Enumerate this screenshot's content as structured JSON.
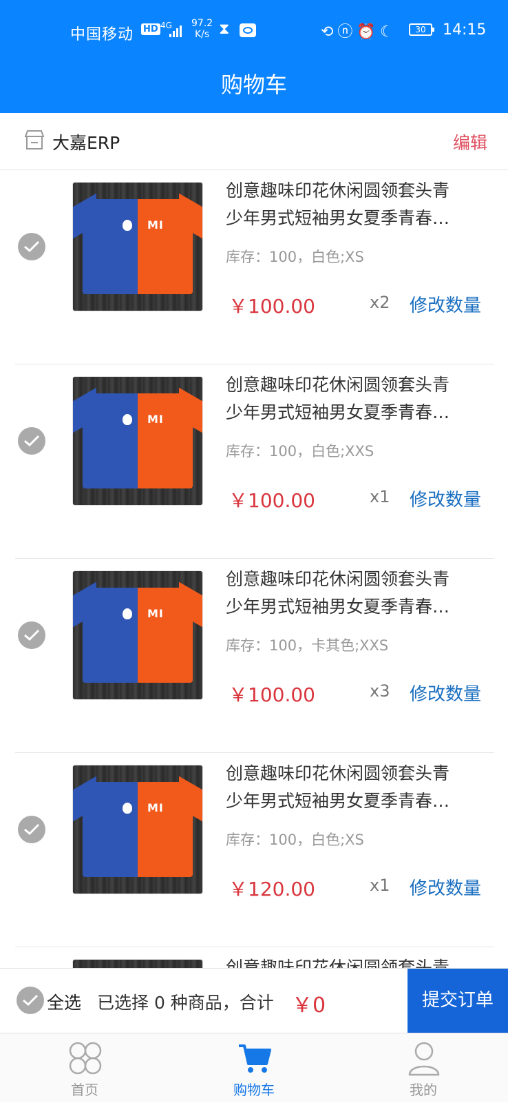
{
  "status_bar": {
    "carrier": "中国移动",
    "hd": "HD",
    "network": "4G",
    "speed_value": "97.2",
    "speed_unit": "K/s",
    "battery": "30",
    "time": "14:15"
  },
  "header": {
    "title": "购物车"
  },
  "shop": {
    "name": "大嘉ERP",
    "edit_label": "编辑"
  },
  "cart_items": [
    {
      "title": "创意趣味印花休闲圆领套头青少年男式短袖男女夏季青春…",
      "spec": "库存：100，白色;XS",
      "price": "￥100.00",
      "qty": "x2",
      "modify_label": "修改数量",
      "checked": true
    },
    {
      "title": "创意趣味印花休闲圆领套头青少年男式短袖男女夏季青春…",
      "spec": "库存：100，白色;XXS",
      "price": "￥100.00",
      "qty": "x1",
      "modify_label": "修改数量",
      "checked": true
    },
    {
      "title": "创意趣味印花休闲圆领套头青少年男式短袖男女夏季青春…",
      "spec": "库存：100，卡其色;XXS",
      "price": "￥100.00",
      "qty": "x3",
      "modify_label": "修改数量",
      "checked": true
    },
    {
      "title": "创意趣味印花休闲圆领套头青少年男式短袖男女夏季青春…",
      "spec": "库存：100，白色;XS",
      "price": "￥120.00",
      "qty": "x1",
      "modify_label": "修改数量",
      "checked": true
    },
    {
      "title": "创意趣味印花休闲圆领套头青少年男式短袖男女夏季青春…",
      "spec": "",
      "price": "",
      "qty": "",
      "modify_label": "",
      "checked": false
    }
  ],
  "summary": {
    "select_all_label": "全选",
    "selected_text": "已选择 0 种商品，合计",
    "total": "￥0",
    "submit_label": "提交订单"
  },
  "tabbar": {
    "home": "首页",
    "cart": "购物车",
    "mine": "我的"
  },
  "colors": {
    "primary": "#0a84ff",
    "price": "#d9363e",
    "link": "#1a6fc0",
    "edit": "#e05060",
    "submit_bg": "#1565d8",
    "checkbox": "#aaaaaa"
  }
}
